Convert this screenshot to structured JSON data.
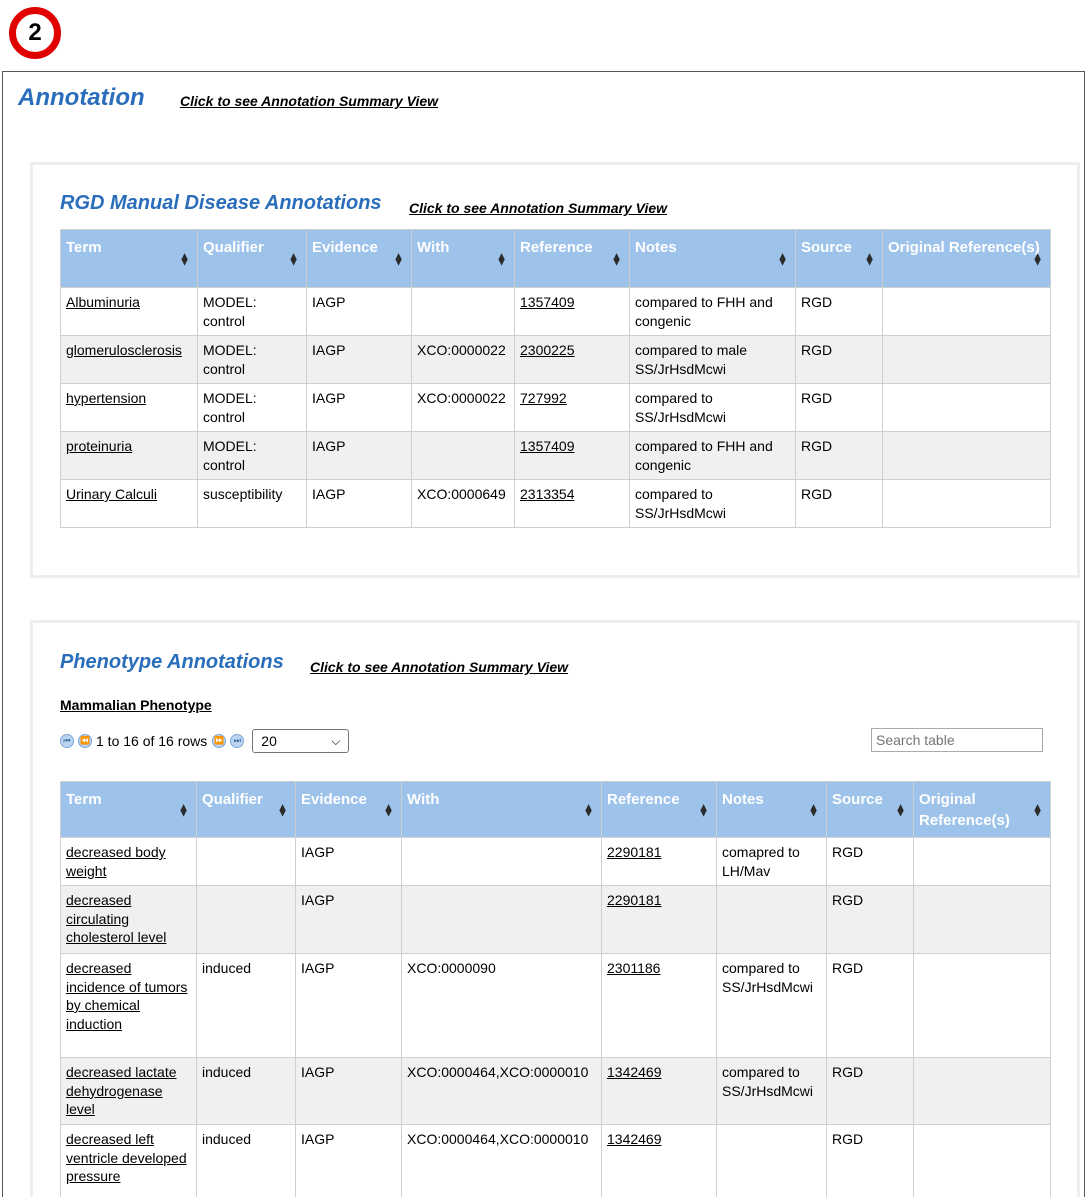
{
  "badge": "2",
  "annotation": {
    "title": "Annotation",
    "summary_link": "Click to see Annotation Summary View"
  },
  "disease": {
    "title": "RGD Manual Disease Annotations",
    "summary_link": "Click to see Annotation Summary View",
    "headers": [
      "Term",
      "Qualifier",
      "Evidence",
      "With",
      "Reference",
      "Notes",
      "Source",
      "Original Reference(s)"
    ],
    "rows": [
      {
        "term": "Albuminuria",
        "qualifier": "MODEL: control",
        "evidence": "IAGP",
        "with": "",
        "reference": "1357409",
        "notes": "compared to FHH and congenic",
        "source": "RGD",
        "original": ""
      },
      {
        "term": "glomerulosclerosis",
        "qualifier": "MODEL: control",
        "evidence": "IAGP",
        "with": "XCO:0000022",
        "reference": "2300225",
        "notes": "compared to male SS/JrHsdMcwi",
        "source": "RGD",
        "original": ""
      },
      {
        "term": "hypertension",
        "qualifier": "MODEL: control",
        "evidence": "IAGP",
        "with": "XCO:0000022",
        "reference": "727992",
        "notes": "compared to SS/JrHsdMcwi",
        "source": "RGD",
        "original": ""
      },
      {
        "term": "proteinuria",
        "qualifier": "MODEL: control",
        "evidence": "IAGP",
        "with": "",
        "reference": "1357409",
        "notes": "compared to FHH and congenic",
        "source": "RGD",
        "original": ""
      },
      {
        "term": "Urinary Calculi",
        "qualifier": "susceptibility",
        "evidence": "IAGP",
        "with": "XCO:0000649",
        "reference": "2313354",
        "notes": "compared to SS/JrHsdMcwi",
        "source": "RGD",
        "original": ""
      }
    ]
  },
  "phenotype": {
    "title": "Phenotype Annotations",
    "summary_link": "Click to see Annotation Summary View",
    "subheading": "Mammalian Phenotype",
    "pager_text": "1 to 16 of 16 rows",
    "page_size": "20",
    "search_placeholder": "Search table",
    "headers": [
      "Term",
      "Qualifier",
      "Evidence",
      "With",
      "Reference",
      "Notes",
      "Source",
      "Original Reference(s)"
    ],
    "rows": [
      {
        "term": "decreased body weight",
        "qualifier": "",
        "evidence": "IAGP",
        "with": "",
        "reference": "2290181",
        "notes": "comapred to LH/Mav",
        "source": "RGD",
        "original": ""
      },
      {
        "term": "decreased circulating cholesterol level",
        "qualifier": "",
        "evidence": "IAGP",
        "with": "",
        "reference": "2290181",
        "notes": "",
        "source": "RGD",
        "original": ""
      },
      {
        "term": "decreased incidence of tumors by chemical induction",
        "qualifier": "induced",
        "evidence": "IAGP",
        "with": "XCO:0000090",
        "reference": "2301186",
        "notes": "compared to SS/JrHsdMcwi",
        "source": "RGD",
        "original": ""
      },
      {
        "term": "decreased lactate dehydrogenase level",
        "qualifier": "induced",
        "evidence": "IAGP",
        "with": "XCO:0000464,XCO:0000010",
        "reference": "1342469",
        "notes": "compared to SS/JrHsdMcwi",
        "source": "RGD",
        "original": ""
      },
      {
        "term": "decreased left ventricle developed pressure",
        "qualifier": "induced",
        "evidence": "IAGP",
        "with": "XCO:0000464,XCO:0000010",
        "reference": "1342469",
        "notes": "",
        "source": "RGD",
        "original": ""
      }
    ]
  }
}
